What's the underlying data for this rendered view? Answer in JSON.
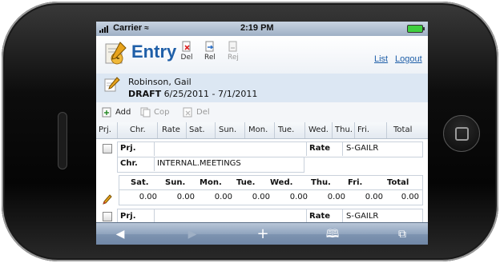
{
  "status_bar": {
    "carrier": "Carrier",
    "time": "2:19 PM"
  },
  "header": {
    "title": "Entry",
    "toolbar": [
      {
        "label": "Del",
        "icon": "delete-doc-icon",
        "enabled": true
      },
      {
        "label": "Rel",
        "icon": "release-doc-icon",
        "enabled": true
      },
      {
        "label": "Rej",
        "icon": "reject-doc-icon",
        "enabled": false
      }
    ],
    "links": {
      "list": "List",
      "logout": "Logout"
    }
  },
  "person": {
    "name": "Robinson, Gail",
    "status": "DRAFT",
    "period": "6/25/2011 - 7/1/2011"
  },
  "actions": [
    {
      "label": "Add",
      "icon": "add-icon",
      "enabled": true
    },
    {
      "label": "Cop",
      "icon": "copy-icon",
      "enabled": false
    },
    {
      "label": "Del",
      "icon": "delete-icon",
      "enabled": false
    }
  ],
  "columns": [
    "Prj.",
    "Chr.",
    "Rate",
    "Sat.",
    "Sun.",
    "Mon.",
    "Tue.",
    "Wed.",
    "Thu.",
    "Fri.",
    "Total"
  ],
  "entries": [
    {
      "prj_label": "Prj.",
      "prj_value": "",
      "rate_label": "Rate",
      "rate_value": "S-GAILR",
      "chr_label": "Chr.",
      "chr_value": "INTERNAL.MEETINGS",
      "day_headers": [
        "Sat.",
        "Sun.",
        "Mon.",
        "Tue.",
        "Wed.",
        "Thu.",
        "Fri.",
        "Total"
      ],
      "day_values": [
        "0.00",
        "0.00",
        "0.00",
        "0.00",
        "0.00",
        "0.00",
        "0.00",
        "0.00"
      ]
    },
    {
      "prj_label": "Prj.",
      "prj_value": "",
      "rate_label": "Rate",
      "rate_value": "S-GAILR"
    }
  ],
  "colors": {
    "accent": "#1f5fa8",
    "header_band": "#dce7f3",
    "toolbar": "#7d93b0"
  }
}
